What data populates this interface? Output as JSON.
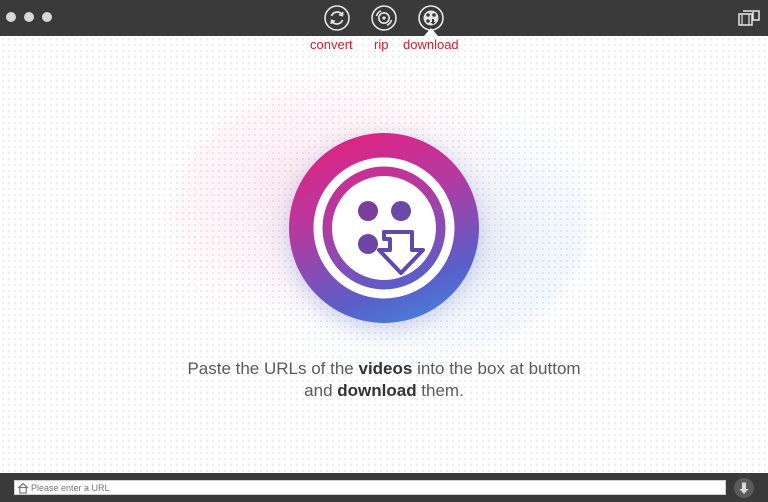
{
  "toolbar": {
    "modes": [
      {
        "id": "convert",
        "label": "convert",
        "icon": "convert-icon"
      },
      {
        "id": "rip",
        "label": "rip",
        "icon": "rip-icon"
      },
      {
        "id": "download",
        "label": "download",
        "icon": "download-film-icon",
        "selected": true
      }
    ],
    "right_icon": "toolbox-icon"
  },
  "main": {
    "logo_icon": "film-reel-download-icon",
    "message": {
      "part1": "Paste the URLs of the ",
      "bold1": "videos",
      "part2": " into the box at buttom",
      "part3": "and ",
      "bold2": "download",
      "part4": " them."
    }
  },
  "bottom": {
    "url_placeholder": "Please enter a URL",
    "url_value": "",
    "home_icon": "home-icon",
    "download_icon": "download-icon"
  },
  "colors": {
    "titlebar": "#3a3a3a",
    "label_red": "#d0202c",
    "logo_gradient": [
      "#e91e7a",
      "#b43aa0",
      "#5a5ec8",
      "#3f8fe0"
    ]
  }
}
